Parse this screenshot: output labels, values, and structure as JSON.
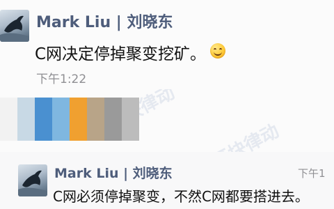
{
  "messages": [
    {
      "sender": "Mark Liu | 刘晓东",
      "text": "C网决定停掉聚变挖矿。",
      "time": "下午1:22",
      "emoji": "smiley-emoji"
    },
    {
      "sender": "Mark Liu | 刘晓东",
      "text": "C网必须停掉聚变，不然C网都要搭进去。",
      "time": "下午1"
    }
  ],
  "redacted_colors": [
    "#f2f2f2",
    "#c8d9e5",
    "#4a90d0",
    "#7fb7e0",
    "#f0a030",
    "#b8a488",
    "#9a9a9a",
    "#bcbcbc"
  ],
  "watermark": {
    "text": "区块律动"
  }
}
